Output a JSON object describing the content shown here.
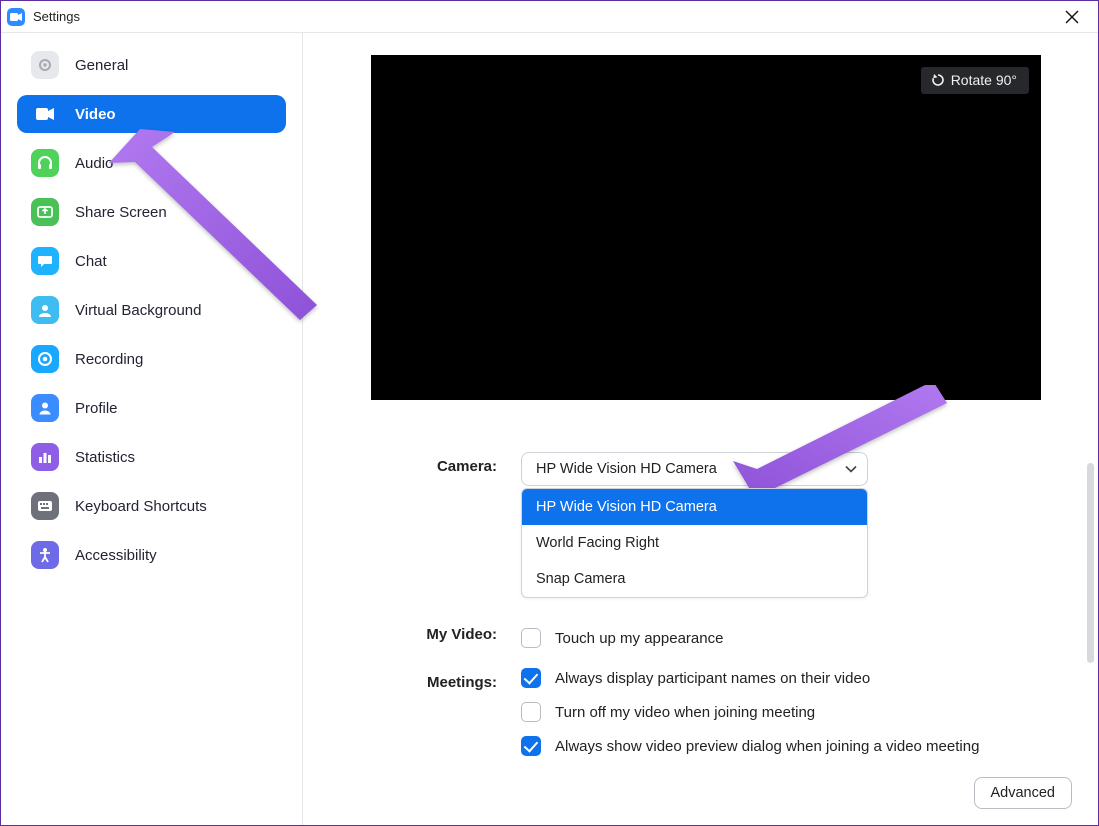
{
  "titlebar": {
    "title": "Settings"
  },
  "sidebar": {
    "items": [
      {
        "label": "General"
      },
      {
        "label": "Video"
      },
      {
        "label": "Audio"
      },
      {
        "label": "Share Screen"
      },
      {
        "label": "Chat"
      },
      {
        "label": "Virtual Background"
      },
      {
        "label": "Recording"
      },
      {
        "label": "Profile"
      },
      {
        "label": "Statistics"
      },
      {
        "label": "Keyboard Shortcuts"
      },
      {
        "label": "Accessibility"
      }
    ]
  },
  "preview": {
    "rotate_label": "Rotate 90°"
  },
  "form": {
    "camera_label": "Camera:",
    "camera_value": "HP Wide Vision HD Camera",
    "camera_options": [
      "HP Wide Vision HD Camera",
      "World Facing Right",
      "Snap Camera"
    ],
    "myvideo_label": "My Video:",
    "myvideo_touchup": "Touch up my appearance",
    "meetings_label": "Meetings:",
    "meetings_opts": [
      {
        "label": "Always display participant names on their video",
        "checked": true
      },
      {
        "label": "Turn off my video when joining meeting",
        "checked": false
      },
      {
        "label": "Always show video preview dialog when joining a video meeting",
        "checked": true
      }
    ],
    "advanced_label": "Advanced"
  }
}
